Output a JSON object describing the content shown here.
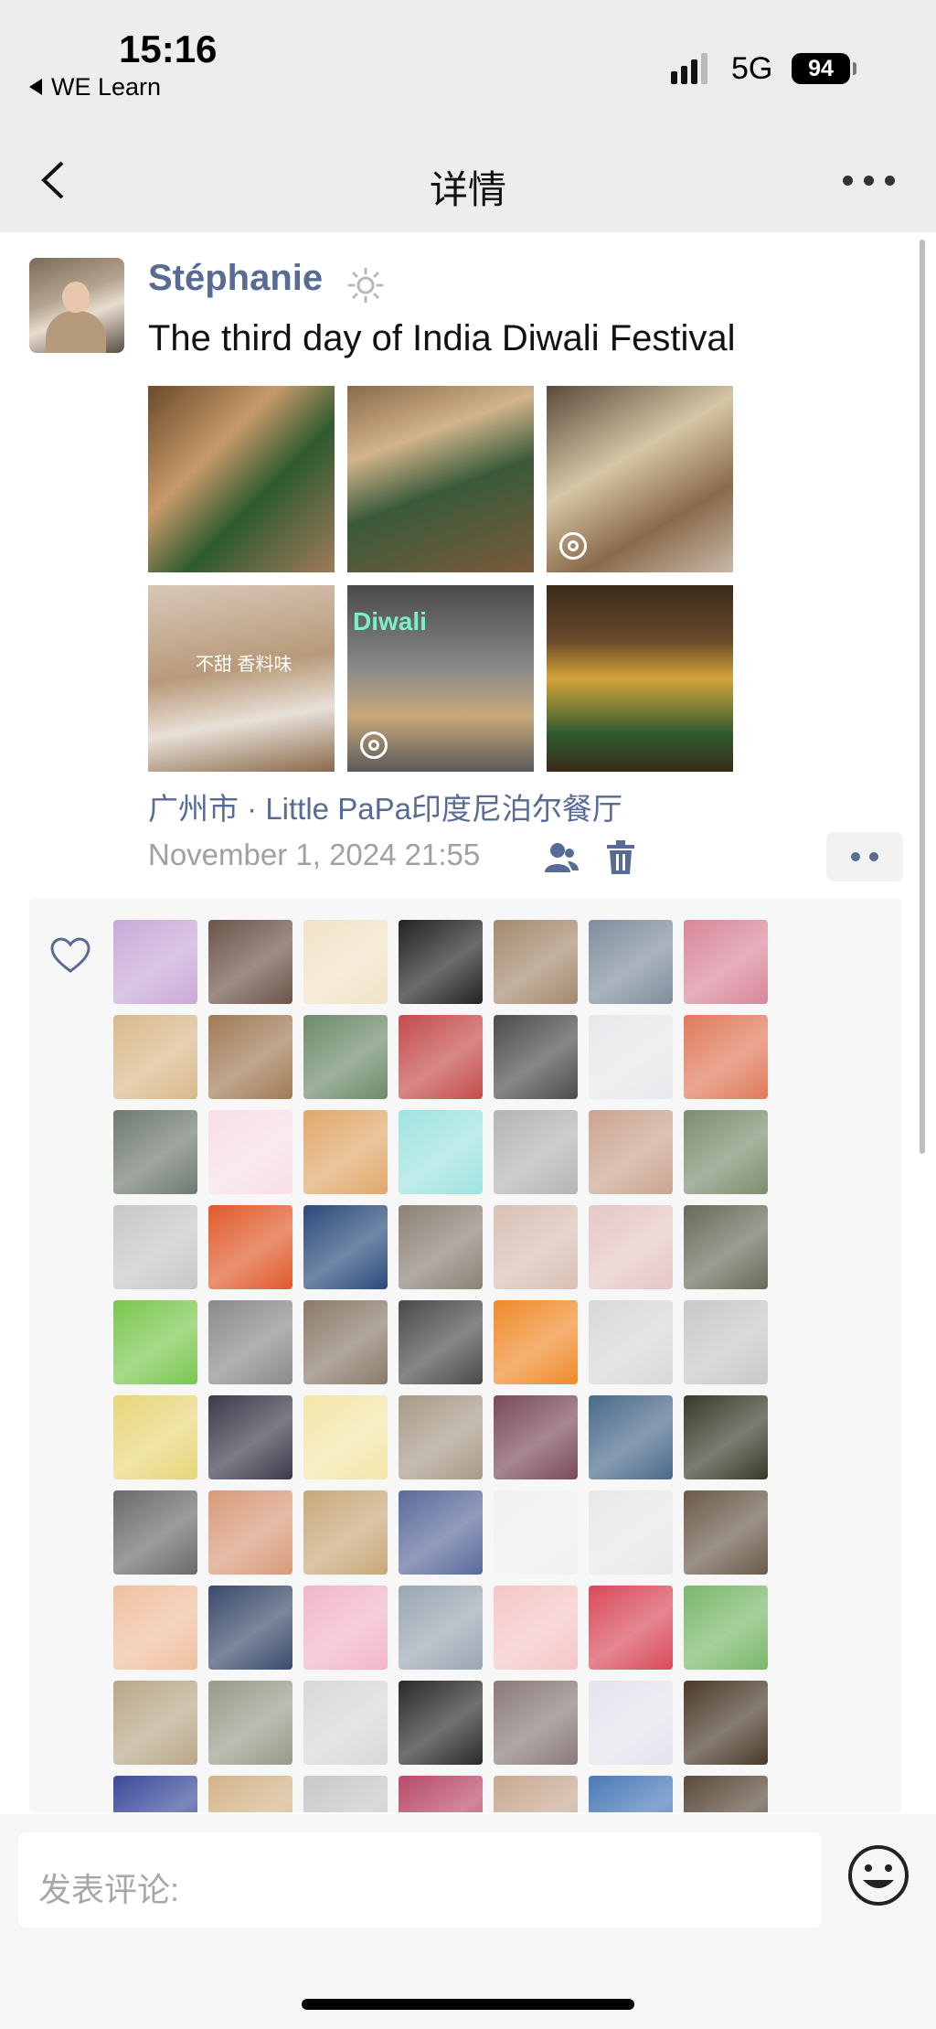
{
  "status": {
    "time": "15:16",
    "back_app": "WE Learn",
    "network": "5G",
    "battery": "94"
  },
  "nav": {
    "title": "详情",
    "back_icon": "chevron-left-icon",
    "more_icon": "more-horizontal-icon"
  },
  "post": {
    "author": "Stéphanie",
    "author_badge_icon": "sun-icon",
    "text": "The third day of India Diwali Festival",
    "photos": [
      {
        "kind": "people",
        "live": false
      },
      {
        "kind": "people",
        "live": false
      },
      {
        "kind": "people",
        "live": true
      },
      {
        "kind": "drinks",
        "label": "不甜 香料味",
        "live": false
      },
      {
        "kind": "screen",
        "label": "Diwali",
        "live": true
      },
      {
        "kind": "people",
        "live": false
      }
    ],
    "location": "广州市 · Little PaPa印度尼泊尔餐厅",
    "datetime": "November 1, 2024 21:55",
    "privacy_icon": "people-icon",
    "delete_icon": "trash-icon",
    "more_icon": "more-dots-icon"
  },
  "likes": {
    "icon": "heart-icon",
    "avatars": [
      "#c9a9d8",
      "#6b5448",
      "#f1e3c7",
      "#222222",
      "#a48a6e",
      "#7f8e9d",
      "#d8879a",
      "#d9b98a",
      "#a07a55",
      "#6d8a6a",
      "#c44b4b",
      "#4b4b4b",
      "#e8e8ec",
      "#e07a5a",
      "#6f7a70",
      "#f7dfe6",
      "#e0a86a",
      "#9fe3e0",
      "#b4b4b4",
      "#caa48f",
      "#7d8d6f",
      "#c7c7c7",
      "#e05a2a",
      "#2a4a7a",
      "#8b8175",
      "#d8c0b4",
      "#e6c7c7",
      "#6a6a5a",
      "#7ac74e",
      "#8a8a8a",
      "#8a7a6a",
      "#4a4a4a",
      "#f08a2a",
      "#d8d8d8",
      "#c8c8c8",
      "#e8d67a",
      "#3a3a4a",
      "#f3e6a8",
      "#a89a88",
      "#7a4a5a",
      "#4a6a8a",
      "#3a3a2a",
      "#6a6a6a",
      "#d89a7a",
      "#c8a87a",
      "#5a6a9a",
      "#f0f0f0",
      "#e8e8e8",
      "#6a5a4a",
      "#f0c0a0",
      "#3a4a6a",
      "#f2b6c9",
      "#9aa6b2",
      "#f5c6c6",
      "#d84a5a",
      "#7ab86a",
      "#b8a888",
      "#9a9a8a",
      "#d8d8d8",
      "#2a2a2a",
      "#8a7a7a",
      "#e4e4ee",
      "#4a3a2a",
      "#3a4a9a",
      "#d4b48a",
      "#c8c8c8",
      "#b84a6a",
      "#c8a890",
      "#4a7ab8",
      "#5a4a3a"
    ]
  },
  "comment": {
    "placeholder": "发表评论:",
    "emoji_icon": "emoji-icon"
  }
}
